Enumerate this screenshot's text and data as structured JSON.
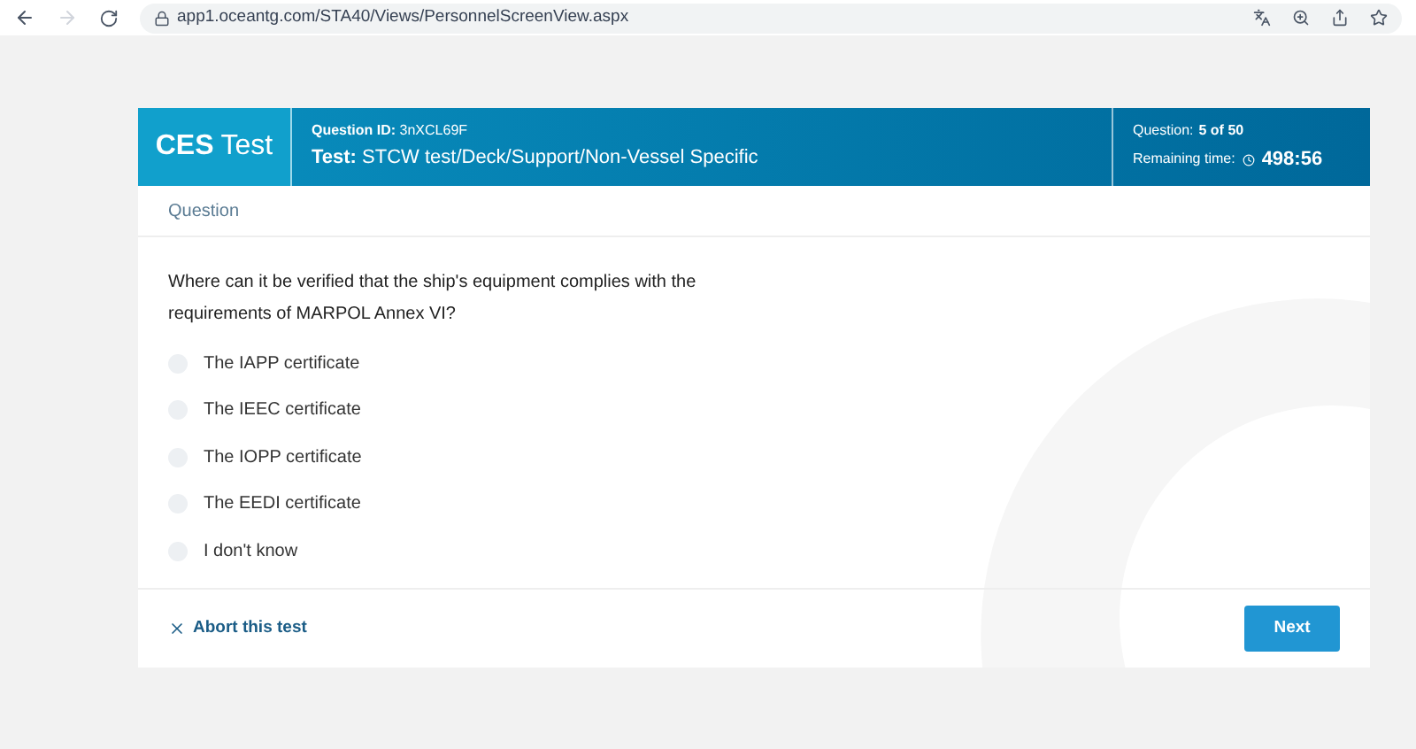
{
  "browser": {
    "url": "app1.oceantg.com/STA40/Views/PersonnelScreenView.aspx"
  },
  "header": {
    "logo_bold": "CES",
    "logo_text": "Test",
    "question_id": "**Question ID:** 3nXCL69F",
    "test": "**Test:** STCW test/Deck/Support/Non-Vessel Specific",
    "progress_label": "Question:",
    "progress_value": "5 of 50",
    "remaining_label": "Remaining time:",
    "remaining_time": "498:56"
  },
  "section_title": "Question",
  "question": "Where can it be verified that the ship's equipment complies with the requirements of MARPOL Annex VI?",
  "options": [
    {
      "label": "The IAPP certificate",
      "selected": false
    },
    {
      "label": "The IEEC certificate",
      "selected": false
    },
    {
      "label": "The IOPP certificate",
      "selected": false
    },
    {
      "label": "The EEDI certificate",
      "selected": false
    },
    {
      "label": "I don't know",
      "selected": false
    }
  ],
  "footer": {
    "abort": "Abort this test",
    "next": "Next"
  }
}
